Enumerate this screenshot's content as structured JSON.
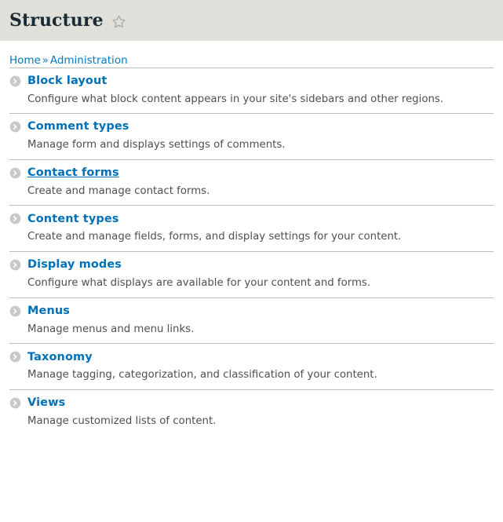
{
  "header": {
    "title": "Structure",
    "star_icon": "star-outline-icon"
  },
  "breadcrumb": {
    "items": [
      {
        "label": "Home"
      },
      {
        "label": "Administration"
      }
    ],
    "separator": "»"
  },
  "main": {
    "items": [
      {
        "icon": "chevron-right-circle-icon",
        "title": "Block layout",
        "description": "Configure what block content appears in your site's sidebars and other regions.",
        "hovered": false
      },
      {
        "icon": "chevron-right-circle-icon",
        "title": "Comment types",
        "description": "Manage form and displays settings of comments.",
        "hovered": false
      },
      {
        "icon": "chevron-right-circle-icon",
        "title": "Contact forms",
        "description": "Create and manage contact forms.",
        "hovered": true
      },
      {
        "icon": "chevron-right-circle-icon",
        "title": "Content types",
        "description": "Create and manage fields, forms, and display settings for your content.",
        "hovered": false
      },
      {
        "icon": "chevron-right-circle-icon",
        "title": "Display modes",
        "description": "Configure what displays are available for your content and forms.",
        "hovered": false
      },
      {
        "icon": "chevron-right-circle-icon",
        "title": "Menus",
        "description": "Manage menus and menu links.",
        "hovered": false
      },
      {
        "icon": "chevron-right-circle-icon",
        "title": "Taxonomy",
        "description": "Manage tagging, categorization, and classification of your content.",
        "hovered": false
      },
      {
        "icon": "chevron-right-circle-icon",
        "title": "Views",
        "description": "Manage customized lists of content.",
        "hovered": false
      }
    ]
  },
  "colors": {
    "header_bg": "#dfe0da",
    "link_blue": "#0071b8",
    "breadcrumb_blue": "#0678be",
    "description_gray": "#4f4f4f",
    "divider_gray": "#bcbcbc",
    "icon_gray": "#c9c9c9",
    "title_dark": "#1a2a33"
  }
}
